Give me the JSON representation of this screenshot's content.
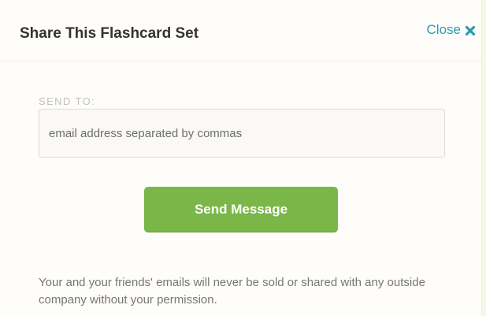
{
  "modal": {
    "title": "Share This Flashcard Set",
    "close_label": "Close",
    "close_icon": "close-x-icon"
  },
  "form": {
    "send_to_label": "SEND TO:",
    "email_value": "",
    "email_placeholder": "email address separated by commas",
    "send_button_label": "Send Message"
  },
  "privacy_note": "Your and your friends' emails will never be sold or shared with any outside company without your permission.",
  "colors": {
    "accent_link": "#2a9bb5",
    "button_green": "#7ab648",
    "page_background": "#f6f8e6"
  }
}
